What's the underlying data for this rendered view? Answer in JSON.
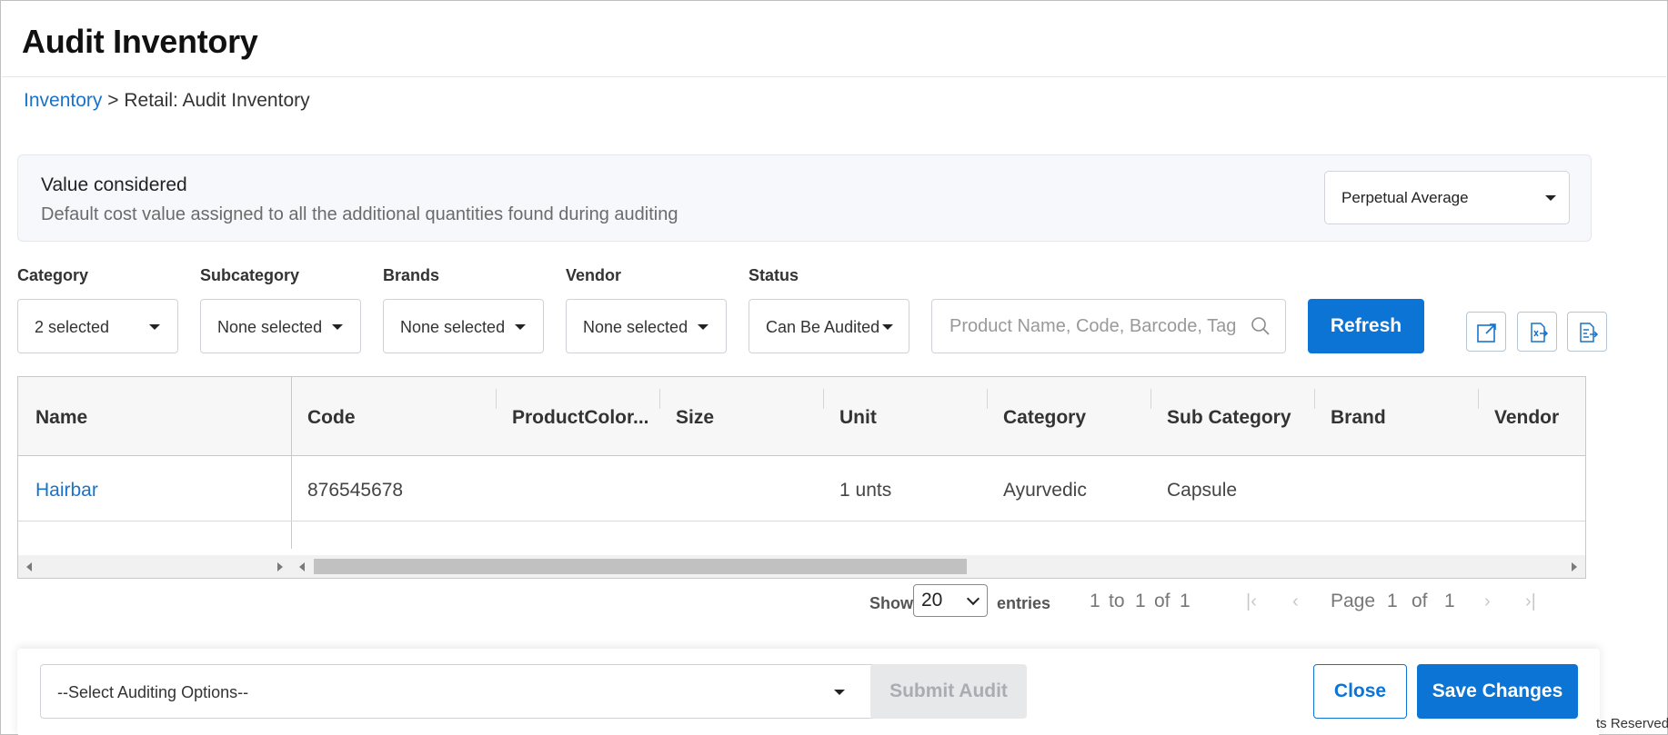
{
  "page": {
    "title": "Audit Inventory"
  },
  "breadcrumb": {
    "root": "Inventory",
    "separator": ">",
    "current": "Retail: Audit Inventory"
  },
  "value_considered": {
    "title": "Value considered",
    "description": "Default cost value assigned to all the additional quantities found during auditing",
    "selected": "Perpetual Average"
  },
  "filters": {
    "category": {
      "label": "Category",
      "value": "2 selected"
    },
    "subcategory": {
      "label": "Subcategory",
      "value": "None selected"
    },
    "brands": {
      "label": "Brands",
      "value": "None selected"
    },
    "vendor": {
      "label": "Vendor",
      "value": "None selected"
    },
    "status": {
      "label": "Status",
      "value": "Can Be Audited"
    },
    "search_placeholder": "Product Name, Code, Barcode, Tag",
    "refresh_label": "Refresh"
  },
  "toolbar_icons": [
    "open-external-icon",
    "export-excel-icon",
    "export-file-icon"
  ],
  "table": {
    "columns": [
      "Name",
      "Code",
      "ProductColor...",
      "Size",
      "Unit",
      "Category",
      "Sub Category",
      "Brand",
      "Vendor"
    ],
    "rows": [
      {
        "name": "Hairbar",
        "code": "876545678",
        "color": "",
        "size": "",
        "unit": "1 unts",
        "category": "Ayurvedic",
        "subcategory": "Capsule",
        "brand": "",
        "vendor": ""
      }
    ]
  },
  "pagination": {
    "show_label": "Show",
    "page_size": "20",
    "entries_label": "entries",
    "range_from": "1",
    "range_to_label": "to",
    "range_to": "1",
    "of_label": "of",
    "total": "1",
    "page_label": "Page",
    "current_page": "1",
    "total_pages": "1"
  },
  "footer": {
    "audit_options_placeholder": "--Select Auditing Options--",
    "submit_label": "Submit Audit",
    "close_label": "Close",
    "save_label": "Save Changes",
    "copyright_fragment": "ts Reserved"
  },
  "colors": {
    "primary": "#0b74d4",
    "link": "#1a73c9",
    "panel_bg": "#f6f8fb"
  }
}
